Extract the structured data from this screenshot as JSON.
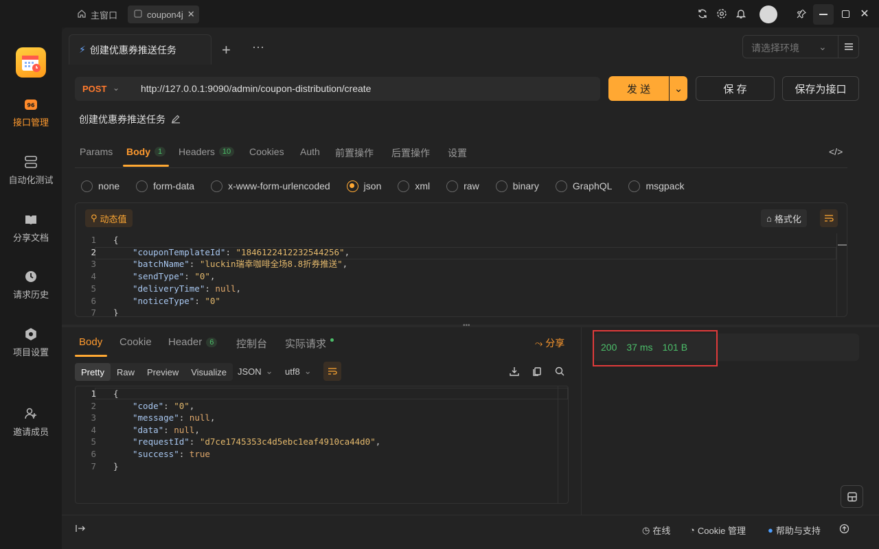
{
  "window": {
    "tabs": [
      {
        "label": "主窗口",
        "icon": "home-icon"
      },
      {
        "label": "coupon4j",
        "icon": "refresh-icon"
      }
    ],
    "controls": [
      "sync-icon",
      "settings-icon",
      "bell-icon",
      "avatar",
      "pin-icon",
      "minimize-icon",
      "maximize-icon",
      "close-icon"
    ]
  },
  "sidebar": {
    "items": [
      {
        "label": "接口管理",
        "icon": "api-icon",
        "active": true
      },
      {
        "label": "自动化测试",
        "icon": "automation-icon"
      },
      {
        "label": "分享文档",
        "icon": "book-icon"
      },
      {
        "label": "请求历史",
        "icon": "clock-icon"
      },
      {
        "label": "项目设置",
        "icon": "gear-icon"
      },
      {
        "label": "邀请成员",
        "icon": "add-user-icon"
      }
    ]
  },
  "request_tab": {
    "label": "创建优惠券推送任务"
  },
  "env": {
    "placeholder": "请选择环境"
  },
  "request": {
    "method": "POST",
    "url": "http://127.0.0.1:9090/admin/coupon-distribution/create",
    "name": "创建优惠券推送任务",
    "send_label": "发 送",
    "save_label": "保 存",
    "save_as_label": "保存为接口"
  },
  "param_tabs": [
    {
      "label": "Params"
    },
    {
      "label": "Body",
      "badge": "1",
      "active": true
    },
    {
      "label": "Headers",
      "badge": "10"
    },
    {
      "label": "Cookies"
    },
    {
      "label": "Auth"
    },
    {
      "label": "前置操作"
    },
    {
      "label": "后置操作"
    },
    {
      "label": "设置"
    }
  ],
  "body_types": [
    "none",
    "form-data",
    "x-www-form-urlencoded",
    "json",
    "xml",
    "raw",
    "binary",
    "GraphQL",
    "msgpack"
  ],
  "body_type_selected": "json",
  "editor": {
    "dynamic_label": "动态值",
    "format_label": "格式化",
    "lines": [
      {
        "n": "1",
        "text": "{"
      },
      {
        "n": "2",
        "key": "\"couponTemplateId\"",
        "val": "\"1846122412232544256\"",
        "tail": ","
      },
      {
        "n": "3",
        "key": "\"batchName\"",
        "val": "\"luckin瑞幸咖啡全场8.8折券推送\"",
        "tail": ","
      },
      {
        "n": "4",
        "key": "\"sendType\"",
        "val": "\"0\"",
        "tail": ","
      },
      {
        "n": "5",
        "key": "\"deliveryTime\"",
        "kw": "null",
        "tail": ","
      },
      {
        "n": "6",
        "key": "\"noticeType\"",
        "val": "\"0\"",
        "tail": ""
      },
      {
        "n": "7",
        "text": "}"
      }
    ]
  },
  "response": {
    "tabs": [
      {
        "label": "Body",
        "active": true
      },
      {
        "label": "Cookie"
      },
      {
        "label": "Header",
        "badge": "6"
      },
      {
        "label": "控制台"
      },
      {
        "label": "实际请求"
      }
    ],
    "share_label": "分享",
    "view_tabs": [
      "Pretty",
      "Raw",
      "Preview",
      "Visualize"
    ],
    "view_selected": "Pretty",
    "format": "JSON",
    "encoding": "utf8",
    "lines": [
      {
        "n": "1",
        "text": "{"
      },
      {
        "n": "2",
        "key": "\"code\"",
        "val": "\"0\"",
        "tail": ","
      },
      {
        "n": "3",
        "key": "\"message\"",
        "kw": "null",
        "tail": ","
      },
      {
        "n": "4",
        "key": "\"data\"",
        "kw": "null",
        "tail": ","
      },
      {
        "n": "5",
        "key": "\"requestId\"",
        "val": "\"d7ce1745353c4d5ebc1eaf4910ca44d0\"",
        "tail": ","
      },
      {
        "n": "6",
        "key": "\"success\"",
        "kw": "true",
        "tail": ""
      },
      {
        "n": "7",
        "text": "}"
      }
    ],
    "status": {
      "code": "200",
      "time": "37 ms",
      "size": "101 B"
    }
  },
  "footer": {
    "online": "在线",
    "cookie": "Cookie 管理",
    "help": "帮助与支持"
  },
  "colors": {
    "accent": "#ffa833",
    "success": "#4cbf6a",
    "highlight": "#e03b3b"
  }
}
